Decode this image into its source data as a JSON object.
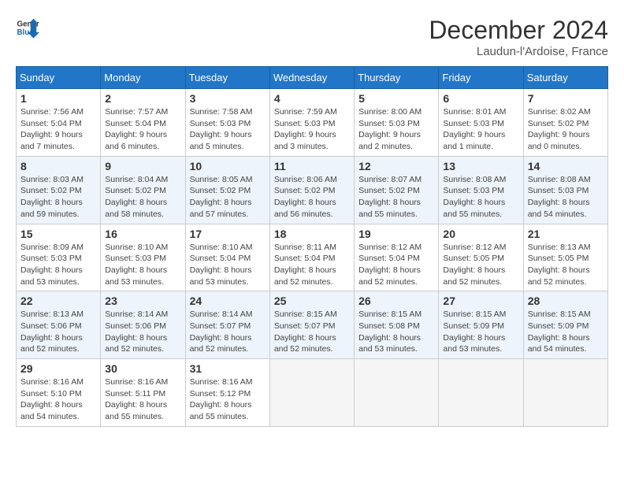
{
  "logo": {
    "general": "General",
    "blue": "Blue"
  },
  "title": "December 2024",
  "subtitle": "Laudun-l'Ardoise, France",
  "weekdays": [
    "Sunday",
    "Monday",
    "Tuesday",
    "Wednesday",
    "Thursday",
    "Friday",
    "Saturday"
  ],
  "weeks": [
    [
      {
        "day": "1",
        "sunrise": "7:56 AM",
        "sunset": "5:04 PM",
        "daylight": "9 hours and 7 minutes."
      },
      {
        "day": "2",
        "sunrise": "7:57 AM",
        "sunset": "5:04 PM",
        "daylight": "9 hours and 6 minutes."
      },
      {
        "day": "3",
        "sunrise": "7:58 AM",
        "sunset": "5:03 PM",
        "daylight": "9 hours and 5 minutes."
      },
      {
        "day": "4",
        "sunrise": "7:59 AM",
        "sunset": "5:03 PM",
        "daylight": "9 hours and 3 minutes."
      },
      {
        "day": "5",
        "sunrise": "8:00 AM",
        "sunset": "5:03 PM",
        "daylight": "9 hours and 2 minutes."
      },
      {
        "day": "6",
        "sunrise": "8:01 AM",
        "sunset": "5:03 PM",
        "daylight": "9 hours and 1 minute."
      },
      {
        "day": "7",
        "sunrise": "8:02 AM",
        "sunset": "5:02 PM",
        "daylight": "9 hours and 0 minutes."
      }
    ],
    [
      {
        "day": "8",
        "sunrise": "8:03 AM",
        "sunset": "5:02 PM",
        "daylight": "8 hours and 59 minutes."
      },
      {
        "day": "9",
        "sunrise": "8:04 AM",
        "sunset": "5:02 PM",
        "daylight": "8 hours and 58 minutes."
      },
      {
        "day": "10",
        "sunrise": "8:05 AM",
        "sunset": "5:02 PM",
        "daylight": "8 hours and 57 minutes."
      },
      {
        "day": "11",
        "sunrise": "8:06 AM",
        "sunset": "5:02 PM",
        "daylight": "8 hours and 56 minutes."
      },
      {
        "day": "12",
        "sunrise": "8:07 AM",
        "sunset": "5:02 PM",
        "daylight": "8 hours and 55 minutes."
      },
      {
        "day": "13",
        "sunrise": "8:08 AM",
        "sunset": "5:03 PM",
        "daylight": "8 hours and 55 minutes."
      },
      {
        "day": "14",
        "sunrise": "8:08 AM",
        "sunset": "5:03 PM",
        "daylight": "8 hours and 54 minutes."
      }
    ],
    [
      {
        "day": "15",
        "sunrise": "8:09 AM",
        "sunset": "5:03 PM",
        "daylight": "8 hours and 53 minutes."
      },
      {
        "day": "16",
        "sunrise": "8:10 AM",
        "sunset": "5:03 PM",
        "daylight": "8 hours and 53 minutes."
      },
      {
        "day": "17",
        "sunrise": "8:10 AM",
        "sunset": "5:04 PM",
        "daylight": "8 hours and 53 minutes."
      },
      {
        "day": "18",
        "sunrise": "8:11 AM",
        "sunset": "5:04 PM",
        "daylight": "8 hours and 52 minutes."
      },
      {
        "day": "19",
        "sunrise": "8:12 AM",
        "sunset": "5:04 PM",
        "daylight": "8 hours and 52 minutes."
      },
      {
        "day": "20",
        "sunrise": "8:12 AM",
        "sunset": "5:05 PM",
        "daylight": "8 hours and 52 minutes."
      },
      {
        "day": "21",
        "sunrise": "8:13 AM",
        "sunset": "5:05 PM",
        "daylight": "8 hours and 52 minutes."
      }
    ],
    [
      {
        "day": "22",
        "sunrise": "8:13 AM",
        "sunset": "5:06 PM",
        "daylight": "8 hours and 52 minutes."
      },
      {
        "day": "23",
        "sunrise": "8:14 AM",
        "sunset": "5:06 PM",
        "daylight": "8 hours and 52 minutes."
      },
      {
        "day": "24",
        "sunrise": "8:14 AM",
        "sunset": "5:07 PM",
        "daylight": "8 hours and 52 minutes."
      },
      {
        "day": "25",
        "sunrise": "8:15 AM",
        "sunset": "5:07 PM",
        "daylight": "8 hours and 52 minutes."
      },
      {
        "day": "26",
        "sunrise": "8:15 AM",
        "sunset": "5:08 PM",
        "daylight": "8 hours and 53 minutes."
      },
      {
        "day": "27",
        "sunrise": "8:15 AM",
        "sunset": "5:09 PM",
        "daylight": "8 hours and 53 minutes."
      },
      {
        "day": "28",
        "sunrise": "8:15 AM",
        "sunset": "5:09 PM",
        "daylight": "8 hours and 54 minutes."
      }
    ],
    [
      {
        "day": "29",
        "sunrise": "8:16 AM",
        "sunset": "5:10 PM",
        "daylight": "8 hours and 54 minutes."
      },
      {
        "day": "30",
        "sunrise": "8:16 AM",
        "sunset": "5:11 PM",
        "daylight": "8 hours and 55 minutes."
      },
      {
        "day": "31",
        "sunrise": "8:16 AM",
        "sunset": "5:12 PM",
        "daylight": "8 hours and 55 minutes."
      },
      null,
      null,
      null,
      null
    ]
  ],
  "labels": {
    "sunrise": "Sunrise:",
    "sunset": "Sunset:",
    "daylight": "Daylight:"
  }
}
